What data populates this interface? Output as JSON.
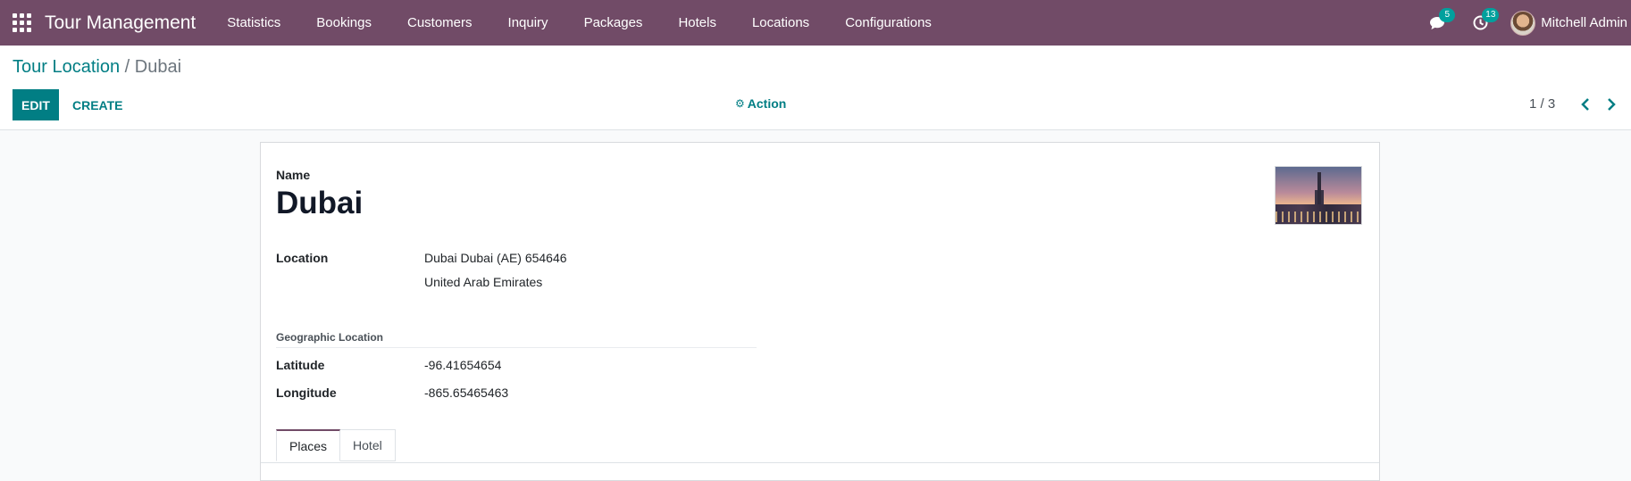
{
  "navbar": {
    "app_title": "Tour Management",
    "menu": [
      "Statistics",
      "Bookings",
      "Customers",
      "Inquiry",
      "Packages",
      "Hotels",
      "Locations",
      "Configurations"
    ],
    "messages_count": "5",
    "activities_count": "13",
    "user_name": "Mitchell Admin",
    "color": "#714b67"
  },
  "control_panel": {
    "breadcrumb_parent": "Tour Location",
    "breadcrumb_separator": "/",
    "breadcrumb_current": "Dubai",
    "edit_label": "EDIT",
    "create_label": "CREATE",
    "action_label": "Action",
    "pager": "1 / 3",
    "accent_color": "#017e84"
  },
  "form": {
    "name_label": "Name",
    "name_value": "Dubai",
    "location_label": "Location",
    "location_line1": "Dubai  Dubai (AE)  654646",
    "location_line2": "United Arab Emirates",
    "geo_section_title": "Geographic Location",
    "latitude_label": "Latitude",
    "latitude_value": "-96.41654654",
    "longitude_label": "Longitude",
    "longitude_value": "-865.65465463",
    "tabs": [
      "Places",
      "Hotel"
    ],
    "active_tab": "Places"
  },
  "icons": {
    "apps": "apps-grid-icon",
    "messages": "chat-icon",
    "activities": "clock-icon",
    "action": "gear-icon",
    "prev": "chevron-left-icon",
    "next": "chevron-right-icon"
  }
}
